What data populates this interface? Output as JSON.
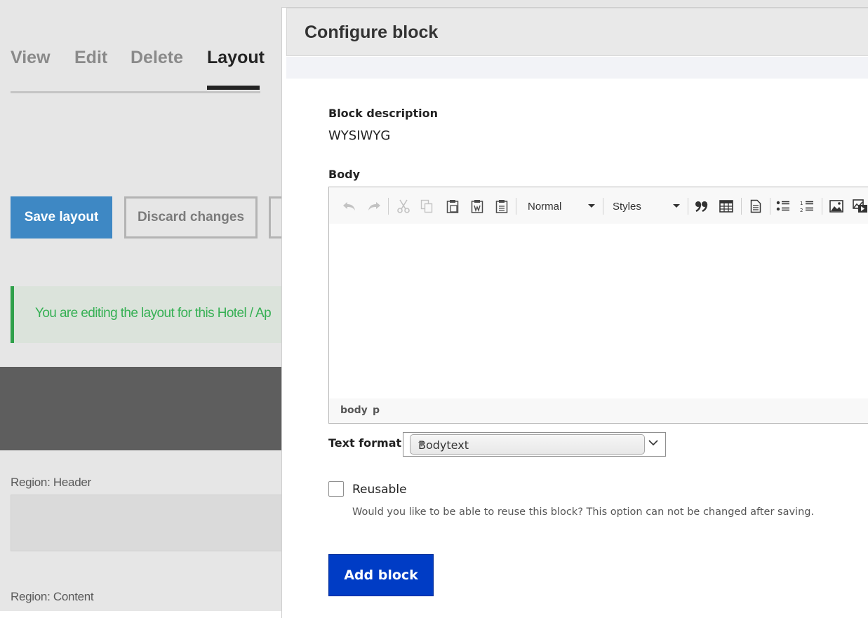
{
  "background": {
    "tabs": [
      {
        "label": "View"
      },
      {
        "label": "Edit"
      },
      {
        "label": "Delete"
      },
      {
        "label": "Layout",
        "active": true
      }
    ],
    "buttons": {
      "save_layout": "Save layout",
      "discard_changes": "Discard changes"
    },
    "message": "You are editing the layout for this Hotel / Ap",
    "regions": {
      "header_label": "Region: Header",
      "content_label": "Region: Content"
    }
  },
  "dialog": {
    "title": "Configure block",
    "block_description_label": "Block description",
    "block_description_value": "WYSIWYG",
    "body_label": "Body",
    "toolbar": {
      "format_value": "Normal",
      "styles_value": "Styles",
      "icons": [
        "undo-icon",
        "redo-icon",
        "cut-icon",
        "copy-icon",
        "paste-icon",
        "paste-from-word-icon",
        "paste-as-text-icon",
        "blockquote-icon",
        "table-icon",
        "source-icon",
        "bulleted-list-icon",
        "numbered-list-icon",
        "image-icon",
        "media-icon"
      ]
    },
    "path": [
      "body",
      "p"
    ],
    "text_format_label": "Text format",
    "text_format_value": "Bodytext",
    "reusable_label": "Reusable",
    "reusable_checked": false,
    "reusable_help": "Would you like to be able to reuse this block? This option can not be changed after saving.",
    "add_block_label": "Add block"
  },
  "colors": {
    "primary_button": "#003cc5",
    "save_layout_button": "#3e88c4",
    "message_text": "#36b054"
  }
}
